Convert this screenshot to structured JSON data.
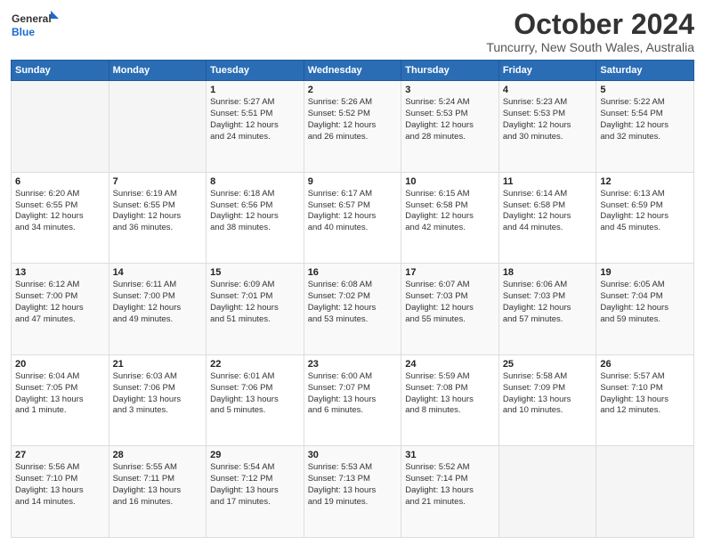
{
  "logo": {
    "line1": "General",
    "line2": "Blue"
  },
  "title": "October 2024",
  "subtitle": "Tuncurry, New South Wales, Australia",
  "weekdays": [
    "Sunday",
    "Monday",
    "Tuesday",
    "Wednesday",
    "Thursday",
    "Friday",
    "Saturday"
  ],
  "weeks": [
    [
      {
        "day": "",
        "info": ""
      },
      {
        "day": "",
        "info": ""
      },
      {
        "day": "1",
        "info": "Sunrise: 5:27 AM\nSunset: 5:51 PM\nDaylight: 12 hours\nand 24 minutes."
      },
      {
        "day": "2",
        "info": "Sunrise: 5:26 AM\nSunset: 5:52 PM\nDaylight: 12 hours\nand 26 minutes."
      },
      {
        "day": "3",
        "info": "Sunrise: 5:24 AM\nSunset: 5:53 PM\nDaylight: 12 hours\nand 28 minutes."
      },
      {
        "day": "4",
        "info": "Sunrise: 5:23 AM\nSunset: 5:53 PM\nDaylight: 12 hours\nand 30 minutes."
      },
      {
        "day": "5",
        "info": "Sunrise: 5:22 AM\nSunset: 5:54 PM\nDaylight: 12 hours\nand 32 minutes."
      }
    ],
    [
      {
        "day": "6",
        "info": "Sunrise: 6:20 AM\nSunset: 6:55 PM\nDaylight: 12 hours\nand 34 minutes."
      },
      {
        "day": "7",
        "info": "Sunrise: 6:19 AM\nSunset: 6:55 PM\nDaylight: 12 hours\nand 36 minutes."
      },
      {
        "day": "8",
        "info": "Sunrise: 6:18 AM\nSunset: 6:56 PM\nDaylight: 12 hours\nand 38 minutes."
      },
      {
        "day": "9",
        "info": "Sunrise: 6:17 AM\nSunset: 6:57 PM\nDaylight: 12 hours\nand 40 minutes."
      },
      {
        "day": "10",
        "info": "Sunrise: 6:15 AM\nSunset: 6:58 PM\nDaylight: 12 hours\nand 42 minutes."
      },
      {
        "day": "11",
        "info": "Sunrise: 6:14 AM\nSunset: 6:58 PM\nDaylight: 12 hours\nand 44 minutes."
      },
      {
        "day": "12",
        "info": "Sunrise: 6:13 AM\nSunset: 6:59 PM\nDaylight: 12 hours\nand 45 minutes."
      }
    ],
    [
      {
        "day": "13",
        "info": "Sunrise: 6:12 AM\nSunset: 7:00 PM\nDaylight: 12 hours\nand 47 minutes."
      },
      {
        "day": "14",
        "info": "Sunrise: 6:11 AM\nSunset: 7:00 PM\nDaylight: 12 hours\nand 49 minutes."
      },
      {
        "day": "15",
        "info": "Sunrise: 6:09 AM\nSunset: 7:01 PM\nDaylight: 12 hours\nand 51 minutes."
      },
      {
        "day": "16",
        "info": "Sunrise: 6:08 AM\nSunset: 7:02 PM\nDaylight: 12 hours\nand 53 minutes."
      },
      {
        "day": "17",
        "info": "Sunrise: 6:07 AM\nSunset: 7:03 PM\nDaylight: 12 hours\nand 55 minutes."
      },
      {
        "day": "18",
        "info": "Sunrise: 6:06 AM\nSunset: 7:03 PM\nDaylight: 12 hours\nand 57 minutes."
      },
      {
        "day": "19",
        "info": "Sunrise: 6:05 AM\nSunset: 7:04 PM\nDaylight: 12 hours\nand 59 minutes."
      }
    ],
    [
      {
        "day": "20",
        "info": "Sunrise: 6:04 AM\nSunset: 7:05 PM\nDaylight: 13 hours\nand 1 minute."
      },
      {
        "day": "21",
        "info": "Sunrise: 6:03 AM\nSunset: 7:06 PM\nDaylight: 13 hours\nand 3 minutes."
      },
      {
        "day": "22",
        "info": "Sunrise: 6:01 AM\nSunset: 7:06 PM\nDaylight: 13 hours\nand 5 minutes."
      },
      {
        "day": "23",
        "info": "Sunrise: 6:00 AM\nSunset: 7:07 PM\nDaylight: 13 hours\nand 6 minutes."
      },
      {
        "day": "24",
        "info": "Sunrise: 5:59 AM\nSunset: 7:08 PM\nDaylight: 13 hours\nand 8 minutes."
      },
      {
        "day": "25",
        "info": "Sunrise: 5:58 AM\nSunset: 7:09 PM\nDaylight: 13 hours\nand 10 minutes."
      },
      {
        "day": "26",
        "info": "Sunrise: 5:57 AM\nSunset: 7:10 PM\nDaylight: 13 hours\nand 12 minutes."
      }
    ],
    [
      {
        "day": "27",
        "info": "Sunrise: 5:56 AM\nSunset: 7:10 PM\nDaylight: 13 hours\nand 14 minutes."
      },
      {
        "day": "28",
        "info": "Sunrise: 5:55 AM\nSunset: 7:11 PM\nDaylight: 13 hours\nand 16 minutes."
      },
      {
        "day": "29",
        "info": "Sunrise: 5:54 AM\nSunset: 7:12 PM\nDaylight: 13 hours\nand 17 minutes."
      },
      {
        "day": "30",
        "info": "Sunrise: 5:53 AM\nSunset: 7:13 PM\nDaylight: 13 hours\nand 19 minutes."
      },
      {
        "day": "31",
        "info": "Sunrise: 5:52 AM\nSunset: 7:14 PM\nDaylight: 13 hours\nand 21 minutes."
      },
      {
        "day": "",
        "info": ""
      },
      {
        "day": "",
        "info": ""
      }
    ]
  ]
}
